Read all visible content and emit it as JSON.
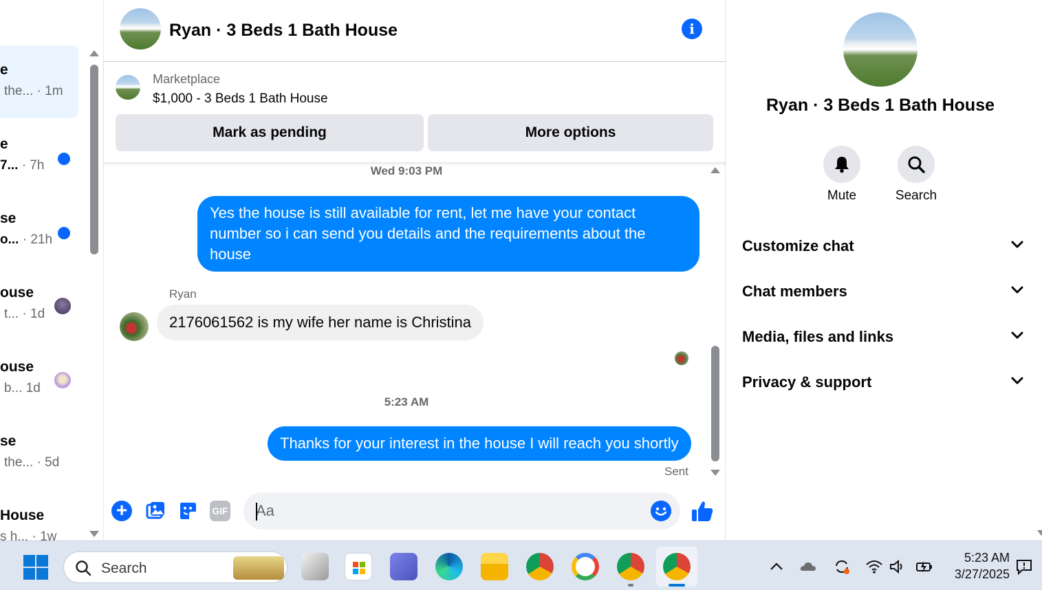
{
  "left_list": {
    "conversations": [
      {
        "title": "e",
        "preview": "the...",
        "time": "· 1m",
        "active": true,
        "indicator": "none"
      },
      {
        "title": "e",
        "preview": "7...",
        "time": "· 7h",
        "active": false,
        "indicator": "unread"
      },
      {
        "title": "se",
        "preview": "o...",
        "time": "· 21h",
        "active": false,
        "indicator": "unread"
      },
      {
        "title": "ouse",
        "preview": "t...",
        "time": "· 1d",
        "active": false,
        "indicator": "avatar"
      },
      {
        "title": "ouse",
        "preview": "b...",
        "time": "1d",
        "active": false,
        "indicator": "avatar"
      },
      {
        "title": "se",
        "preview": "the...",
        "time": "· 5d",
        "active": false,
        "indicator": "none"
      },
      {
        "title": "House",
        "preview": "s h...",
        "time": "· 1w",
        "active": false,
        "indicator": "none"
      }
    ]
  },
  "header": {
    "title": "Ryan · 3 Beds 1 Bath House",
    "info_icon": "info-icon"
  },
  "marketplace": {
    "label": "Marketplace",
    "listing": "$1,000 - 3 Beds 1 Bath House",
    "pending_label": "Mark as pending",
    "more_label": "More options"
  },
  "messages": {
    "timestamp1": "Wed 9:03 PM",
    "out1": "Yes the house is still available for rent, let me have your contact number so i can send you details and the requirements about the house",
    "sender": "Ryan",
    "in1": "2176061562 is my wife her name is Christina",
    "timestamp2": "5:23 AM",
    "out2": "Thanks for your interest in the house I will reach you shortly",
    "status": "Sent"
  },
  "composer": {
    "placeholder": "Aa",
    "gif_label": "GIF"
  },
  "info_panel": {
    "name": "Ryan · 3 Beds 1 Bath House",
    "actions": [
      {
        "label": "Mute",
        "icon": "bell-icon"
      },
      {
        "label": "Search",
        "icon": "search-icon"
      }
    ],
    "sections": [
      "Customize chat",
      "Chat members",
      "Media, files and links",
      "Privacy & support"
    ]
  },
  "taskbar": {
    "search_label": "Search",
    "time": "5:23 AM",
    "date": "3/27/2025"
  },
  "colors": {
    "accent": "#0866ff",
    "bubble_out": "#0084ff",
    "bubble_in": "#f0f0f0",
    "active_row": "#ebf5ff"
  }
}
